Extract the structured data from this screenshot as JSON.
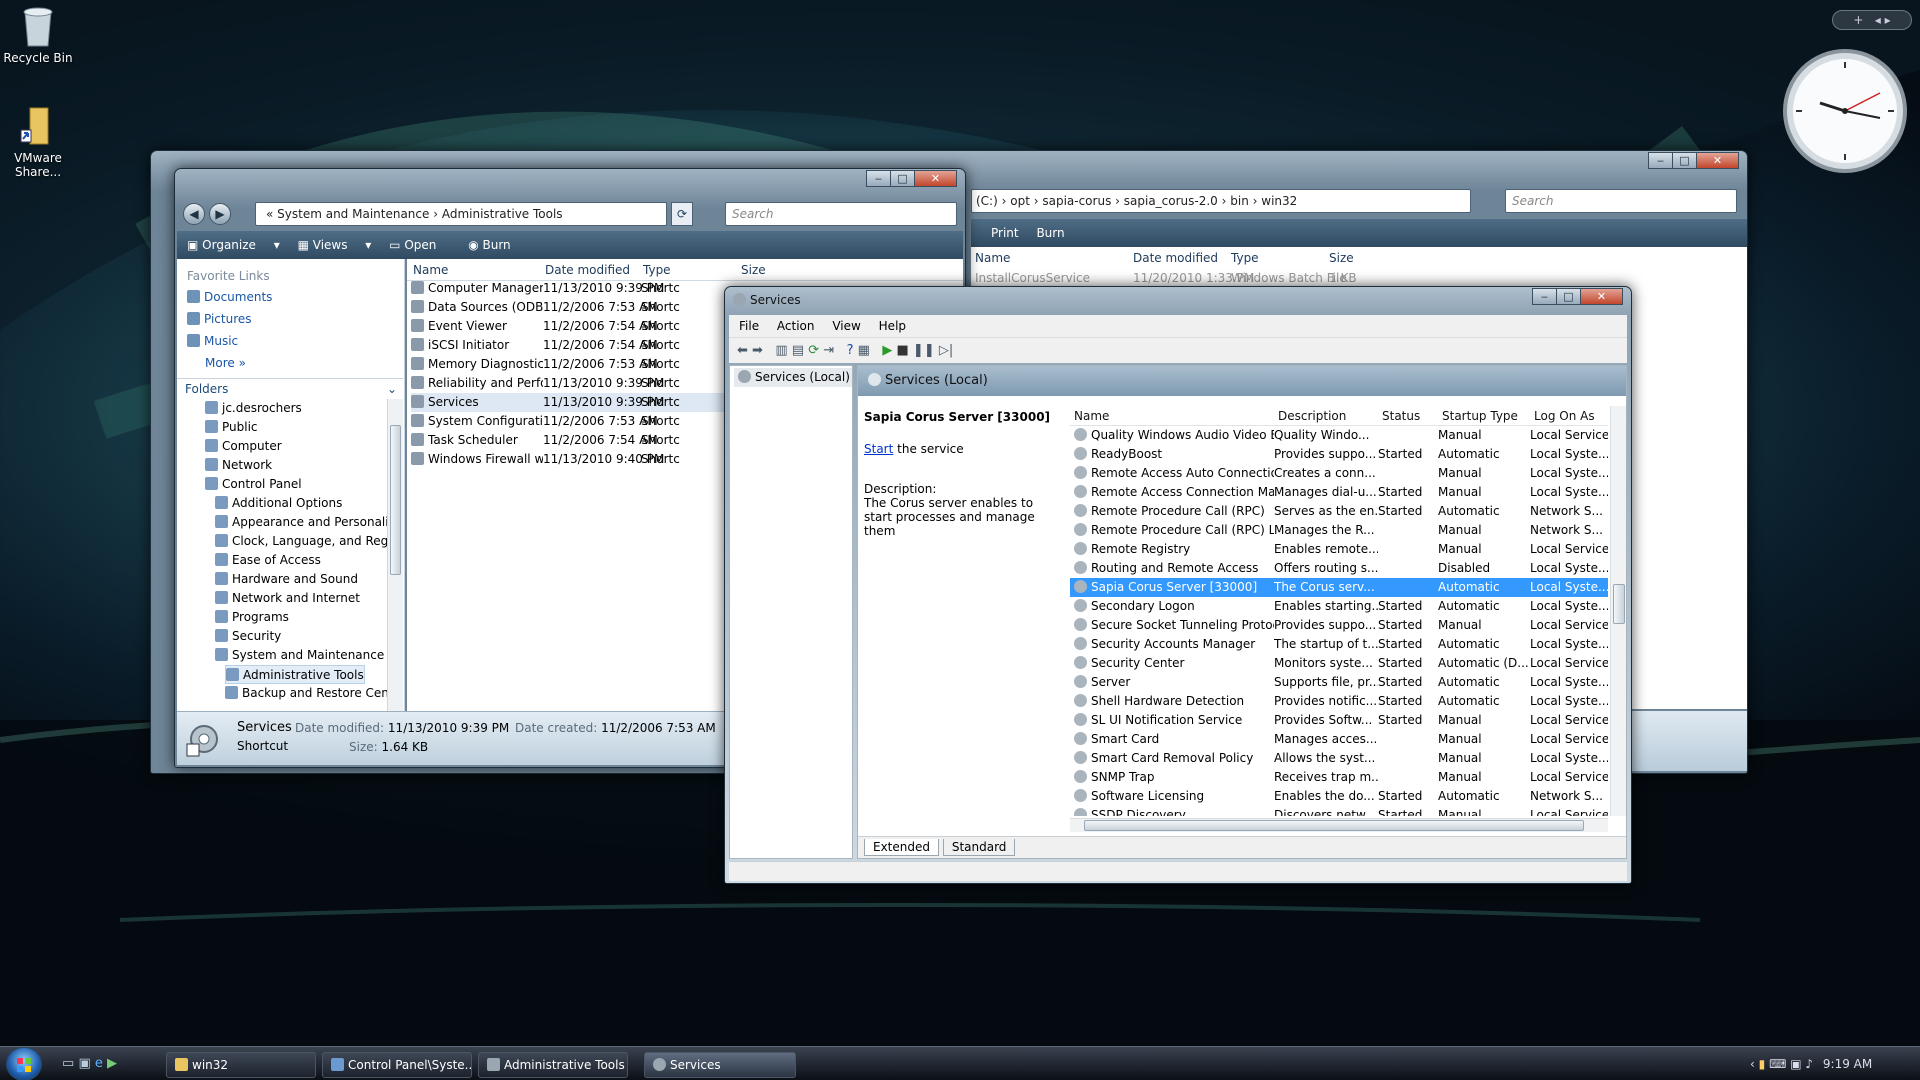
{
  "desktop": {
    "icons": [
      {
        "label": "Recycle Bin",
        "icon": "recycle-bin-icon"
      },
      {
        "label": "VMware Share...",
        "icon": "folder-shortcut-icon"
      }
    ]
  },
  "win32_window": {
    "address": [
      "(C:)",
      "opt",
      "sapia-corus",
      "sapia_corus-2.0",
      "bin",
      "win32"
    ],
    "search": "Search",
    "toolbar": [
      "Print",
      "Burn"
    ],
    "columns": [
      "Name",
      "Date modified",
      "Type",
      "Size"
    ],
    "rows": [
      {
        "name": "InstallCorusService",
        "date": "11/20/2010 1:33 PM",
        "type": "Windows Batch File",
        "size": "1 KB"
      }
    ]
  },
  "admin_window": {
    "address": [
      "System and Maintenance",
      "Administrative Tools"
    ],
    "search": "Search",
    "toolbar": {
      "organize": "Organize",
      "views": "Views",
      "open": "Open",
      "burn": "Burn"
    },
    "favorite_links_title": "Favorite Links",
    "favorite_links": [
      "Documents",
      "Pictures",
      "Music",
      "More"
    ],
    "folders_title": "Folders",
    "folders": [
      {
        "l": "jc.desrochers",
        "i": 0
      },
      {
        "l": "Public",
        "i": 0
      },
      {
        "l": "Computer",
        "i": 0
      },
      {
        "l": "Network",
        "i": 0
      },
      {
        "l": "Control Panel",
        "i": 0
      },
      {
        "l": "Additional Options",
        "i": 1
      },
      {
        "l": "Appearance and Personaliz",
        "i": 1
      },
      {
        "l": "Clock, Language, and Regic",
        "i": 1
      },
      {
        "l": "Ease of Access",
        "i": 1
      },
      {
        "l": "Hardware and Sound",
        "i": 1
      },
      {
        "l": "Network and Internet",
        "i": 1
      },
      {
        "l": "Programs",
        "i": 1
      },
      {
        "l": "Security",
        "i": 1
      },
      {
        "l": "System and Maintenance",
        "i": 1
      },
      {
        "l": "Administrative Tools",
        "i": 2
      },
      {
        "l": "Backup and Restore Cent",
        "i": 2
      }
    ],
    "columns": [
      "Name",
      "Date modified",
      "Type",
      "Size"
    ],
    "rows": [
      {
        "name": "Computer Management",
        "date": "11/13/2010 9:39 PM",
        "type": "Shortc"
      },
      {
        "name": "Data Sources (ODBC)",
        "date": "11/2/2006 7:53 AM",
        "type": "Shortc"
      },
      {
        "name": "Event Viewer",
        "date": "11/2/2006 7:54 AM",
        "type": "Shortc"
      },
      {
        "name": "iSCSI Initiator",
        "date": "11/2/2006 7:54 AM",
        "type": "Shortc"
      },
      {
        "name": "Memory Diagnostics T...",
        "date": "11/2/2006 7:53 AM",
        "type": "Shortc"
      },
      {
        "name": "Reliability and Perform...",
        "date": "11/13/2010 9:39 PM",
        "type": "Shortc"
      },
      {
        "name": "Services",
        "date": "11/13/2010 9:39 PM",
        "type": "Shortc"
      },
      {
        "name": "System Configuration",
        "date": "11/2/2006 7:53 AM",
        "type": "Shortc"
      },
      {
        "name": "Task Scheduler",
        "date": "11/2/2006 7:54 AM",
        "type": "Shortc"
      },
      {
        "name": "Windows Firewall with ...",
        "date": "11/13/2010 9:40 PM",
        "type": "Shortc"
      }
    ],
    "details": {
      "name": "Services",
      "type": "Shortcut",
      "dm_label": "Date modified:",
      "dm": "11/13/2010 9:39 PM",
      "dc_label": "Date created:",
      "dc": "11/2/2006 7:53 AM",
      "size_label": "Size:",
      "size": "1.64 KB"
    }
  },
  "services_window": {
    "title": "Services",
    "menu": [
      "File",
      "Action",
      "View",
      "Help"
    ],
    "tree_item": "Services (Local)",
    "pane_title": "Services (Local)",
    "selected_name": "Sapia Corus Server [33000]",
    "start_link": "Start",
    "start_text": " the service",
    "description_label": "Description:",
    "description": "The Corus server enables to start processes and manage them",
    "columns": [
      "Name",
      "Description",
      "Status",
      "Startup Type",
      "Log On As"
    ],
    "rows": [
      [
        "Quality Windows Audio Video E...",
        "Quality Windo...",
        "",
        "Manual",
        "Local Service"
      ],
      [
        "ReadyBoost",
        "Provides suppo...",
        "Started",
        "Automatic",
        "Local Syste..."
      ],
      [
        "Remote Access Auto Connectio...",
        "Creates a conn...",
        "",
        "Manual",
        "Local Syste..."
      ],
      [
        "Remote Access Connection Ma...",
        "Manages dial-u...",
        "Started",
        "Manual",
        "Local Syste..."
      ],
      [
        "Remote Procedure Call (RPC)",
        "Serves as the en...",
        "Started",
        "Automatic",
        "Network S..."
      ],
      [
        "Remote Procedure Call (RPC) Lo...",
        "Manages the R...",
        "",
        "Manual",
        "Network S..."
      ],
      [
        "Remote Registry",
        "Enables remote...",
        "",
        "Manual",
        "Local Service"
      ],
      [
        "Routing and Remote Access",
        "Offers routing s...",
        "",
        "Disabled",
        "Local Syste..."
      ],
      [
        "Sapia Corus Server [33000]",
        "The Corus serv...",
        "",
        "Automatic",
        "Local Syste..."
      ],
      [
        "Secondary Logon",
        "Enables starting...",
        "Started",
        "Automatic",
        "Local Syste..."
      ],
      [
        "Secure Socket Tunneling Protoc...",
        "Provides suppo...",
        "Started",
        "Manual",
        "Local Service"
      ],
      [
        "Security Accounts Manager",
        "The startup of t...",
        "Started",
        "Automatic",
        "Local Syste..."
      ],
      [
        "Security Center",
        "Monitors syste...",
        "Started",
        "Automatic (D...",
        "Local Service"
      ],
      [
        "Server",
        "Supports file, pr...",
        "Started",
        "Automatic",
        "Local Syste..."
      ],
      [
        "Shell Hardware Detection",
        "Provides notific...",
        "Started",
        "Automatic",
        "Local Syste..."
      ],
      [
        "SL UI Notification Service",
        "Provides Softw...",
        "Started",
        "Manual",
        "Local Service"
      ],
      [
        "Smart Card",
        "Manages acces...",
        "",
        "Manual",
        "Local Service"
      ],
      [
        "Smart Card Removal Policy",
        "Allows the syst...",
        "",
        "Manual",
        "Local Syste..."
      ],
      [
        "SNMP Trap",
        "Receives trap m...",
        "",
        "Manual",
        "Local Service"
      ],
      [
        "Software Licensing",
        "Enables the do...",
        "Started",
        "Automatic",
        "Network S..."
      ],
      [
        "SSDP Discovery",
        "Discovers netw...",
        "Started",
        "Manual",
        "Local Service"
      ]
    ],
    "selected_index": 8,
    "tabs": [
      "Extended",
      "Standard"
    ]
  },
  "taskbar": {
    "buttons": [
      "win32",
      "Control Panel\\Syste...",
      "Administrative Tools",
      "Services"
    ],
    "active": 3,
    "time": "9:19 AM"
  },
  "colors": {
    "selection": "#3399ff",
    "link": "#1a56a6",
    "header_text": "#1d3a5a"
  }
}
